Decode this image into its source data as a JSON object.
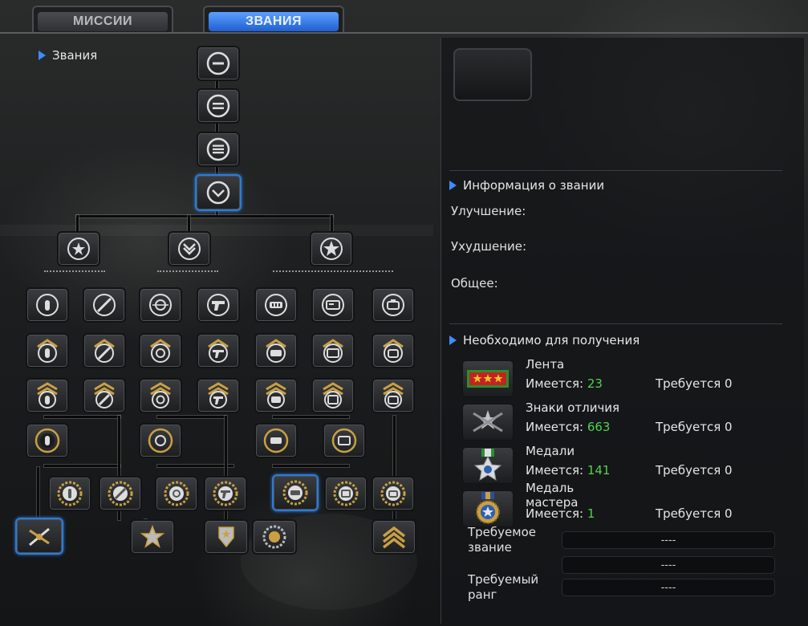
{
  "tabs": [
    {
      "label": "МИССИИ",
      "active": false
    },
    {
      "label": "ЗВАНИЯ",
      "active": true
    }
  ],
  "tree": {
    "title": "Звания"
  },
  "info": {
    "title": "Информация о звании",
    "improvement_label": "Улучшение:",
    "degradation_label": "Ухудшение:",
    "general_label": "Общее:"
  },
  "requirements": {
    "title": "Необходимо для получения",
    "items": [
      {
        "name": "Лента",
        "have_label": "Имеется:",
        "have_value": "23",
        "need": "Требуется 0",
        "icon": "ribbon-icon"
      },
      {
        "name": "Знаки отличия",
        "have_label": "Имеется:",
        "have_value": "663",
        "need": "Требуется 0",
        "icon": "insignia-icon"
      },
      {
        "name": "Медали",
        "have_label": "Имеется:",
        "have_value": "141",
        "need": "Требуется 0",
        "icon": "medal-icon"
      },
      {
        "name": "Медаль\nмастера",
        "have_label": "Имеется:",
        "have_value": "1",
        "need": "Требуется 0",
        "icon": "master-medal-icon"
      }
    ],
    "required_title_label": "Требуемое\nзвание",
    "required_title_value": "----",
    "required_title_value2": "----",
    "required_rank_label": "Требуемый\nранг",
    "required_rank_value": "----"
  },
  "colors": {
    "accent": "#2b7bd8",
    "have_value": "#4fd34f",
    "gold": "#c9a043"
  }
}
